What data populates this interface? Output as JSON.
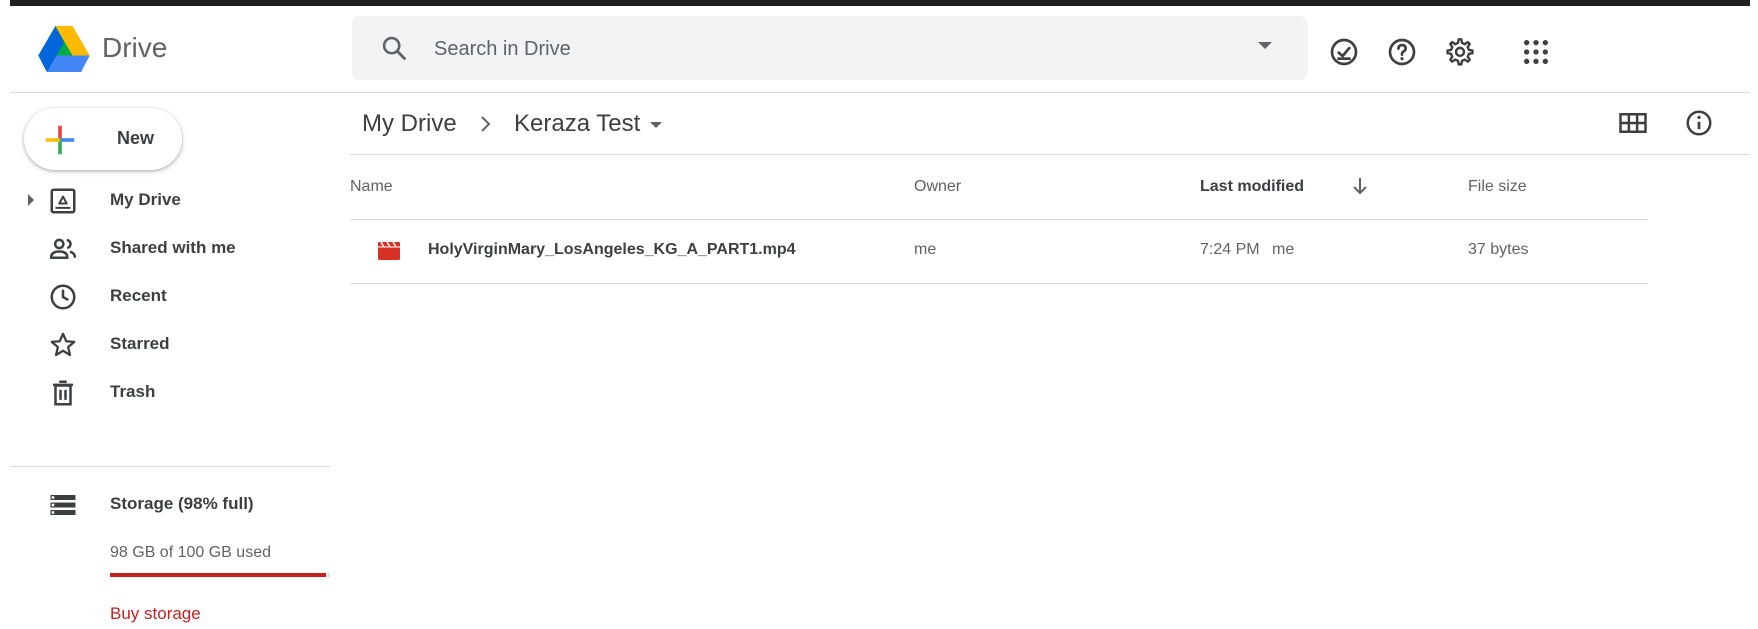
{
  "app": {
    "name": "Drive"
  },
  "search": {
    "placeholder": "Search in Drive"
  },
  "header_icons": [
    "offline-status-icon",
    "help-icon",
    "settings-icon",
    "apps-grid-icon"
  ],
  "sidebar": {
    "new_label": "New",
    "items": [
      {
        "label": "My Drive",
        "icon": "my-drive-icon"
      },
      {
        "label": "Shared with me",
        "icon": "shared-people-icon"
      },
      {
        "label": "Recent",
        "icon": "clock-icon"
      },
      {
        "label": "Starred",
        "icon": "star-icon"
      },
      {
        "label": "Trash",
        "icon": "trash-icon"
      }
    ],
    "storage": {
      "title": "Storage (98% full)",
      "used_text": "98 GB of 100 GB used",
      "used_fraction": 0.98,
      "buy_label": "Buy storage",
      "bar_color": "#c5221f"
    }
  },
  "breadcrumb": {
    "root": "My Drive",
    "current": "Keraza Test"
  },
  "table": {
    "columns": {
      "name": "Name",
      "owner": "Owner",
      "last_modified": "Last modified",
      "file_size": "File size"
    },
    "rows": [
      {
        "name": "HolyVirginMary_LosAngeles_KG_A_PART1.mp4",
        "owner": "me",
        "modified_time": "7:24 PM",
        "modified_by": "me",
        "size": "37 bytes",
        "icon": "video-file-icon"
      }
    ]
  },
  "colors": {
    "accent_red": "#c5221f",
    "video_icon": "#d93025",
    "text_primary": "#3c4043",
    "text_secondary": "#5f6368",
    "divider": "#dadce0",
    "search_bg": "#f1f3f4"
  }
}
